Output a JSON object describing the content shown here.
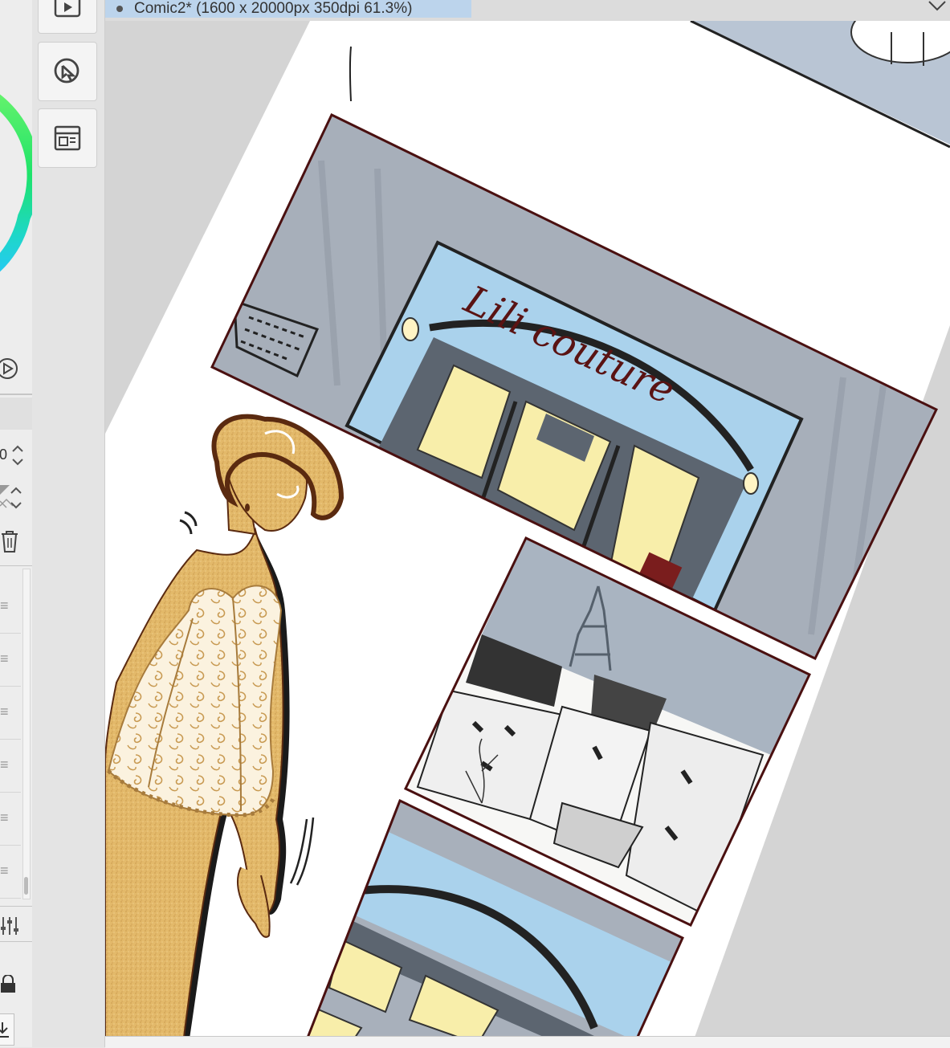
{
  "document_tab": {
    "title": "Comic2* (1600 x 20000px 350dpi 61.3%)"
  },
  "left_panel": {
    "spinner_value": "0"
  },
  "tool_strip": {
    "buttons": [
      {
        "icon": "animation-play-icon"
      },
      {
        "icon": "cursor-circle-icon"
      },
      {
        "icon": "layout-panel-icon"
      }
    ]
  },
  "canvas": {
    "panels": [
      {
        "scene": "storefront-lili-couture",
        "sign_text": "Lili couture"
      },
      {
        "scene": "paris-rooftops-eiffel-tower-moon"
      },
      {
        "scene": "storefront-closeup"
      },
      {
        "scene": "woman-gold-corset"
      }
    ]
  },
  "colors": {
    "accent_tab": "#bcd4ec",
    "panel_border": "#4a1010",
    "sky_blue": "#a9d4ef",
    "window_yellow": "#f8eeaa",
    "gold": "#e3b96a"
  }
}
